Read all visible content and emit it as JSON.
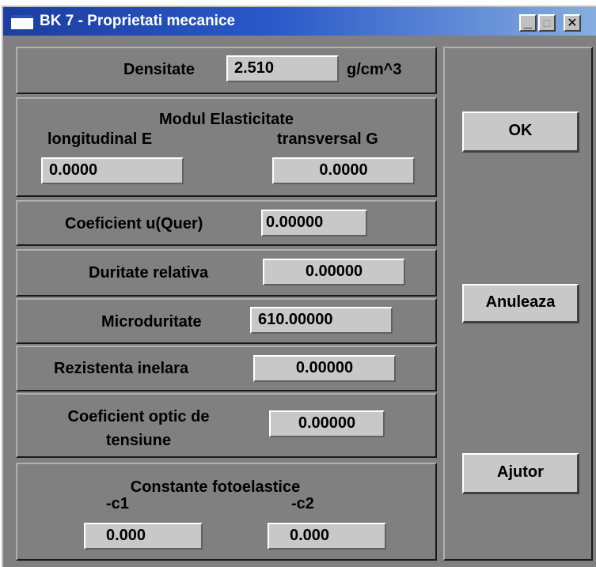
{
  "window": {
    "title": "BK 7 - Proprietati mecanice"
  },
  "titlebar_buttons": {
    "minimize": "_",
    "maximize": "□",
    "close": "✕"
  },
  "density": {
    "label": "Densitate",
    "value": "2.510",
    "unit": "g/cm^3"
  },
  "elasticity": {
    "title": "Modul Elasticitate",
    "longitudinal_label": "longitudinal E",
    "longitudinal_value": "0.0000",
    "transversal_label": "transversal G",
    "transversal_value": "0.0000"
  },
  "poisson": {
    "label": "Coeficient u(Quer)",
    "value": "0.00000"
  },
  "relative_hardness": {
    "label": "Duritate relativa",
    "value": "0.00000"
  },
  "microhardness": {
    "label": "Microduritate",
    "value": "610.00000"
  },
  "ring_resistance": {
    "label": "Rezistenta inelara",
    "value": "0.00000"
  },
  "stress_optic": {
    "label_line1": "Coeficient optic de",
    "label_line2": "tensiune",
    "value": "0.00000"
  },
  "photoelastic": {
    "title": "Constante fotoelastice",
    "c1_label": "-c1",
    "c1_value": "0.000",
    "c2_label": "-c2",
    "c2_value": "0.000"
  },
  "buttons": {
    "ok": "OK",
    "cancel": "Anuleaza",
    "help": "Ajutor"
  }
}
